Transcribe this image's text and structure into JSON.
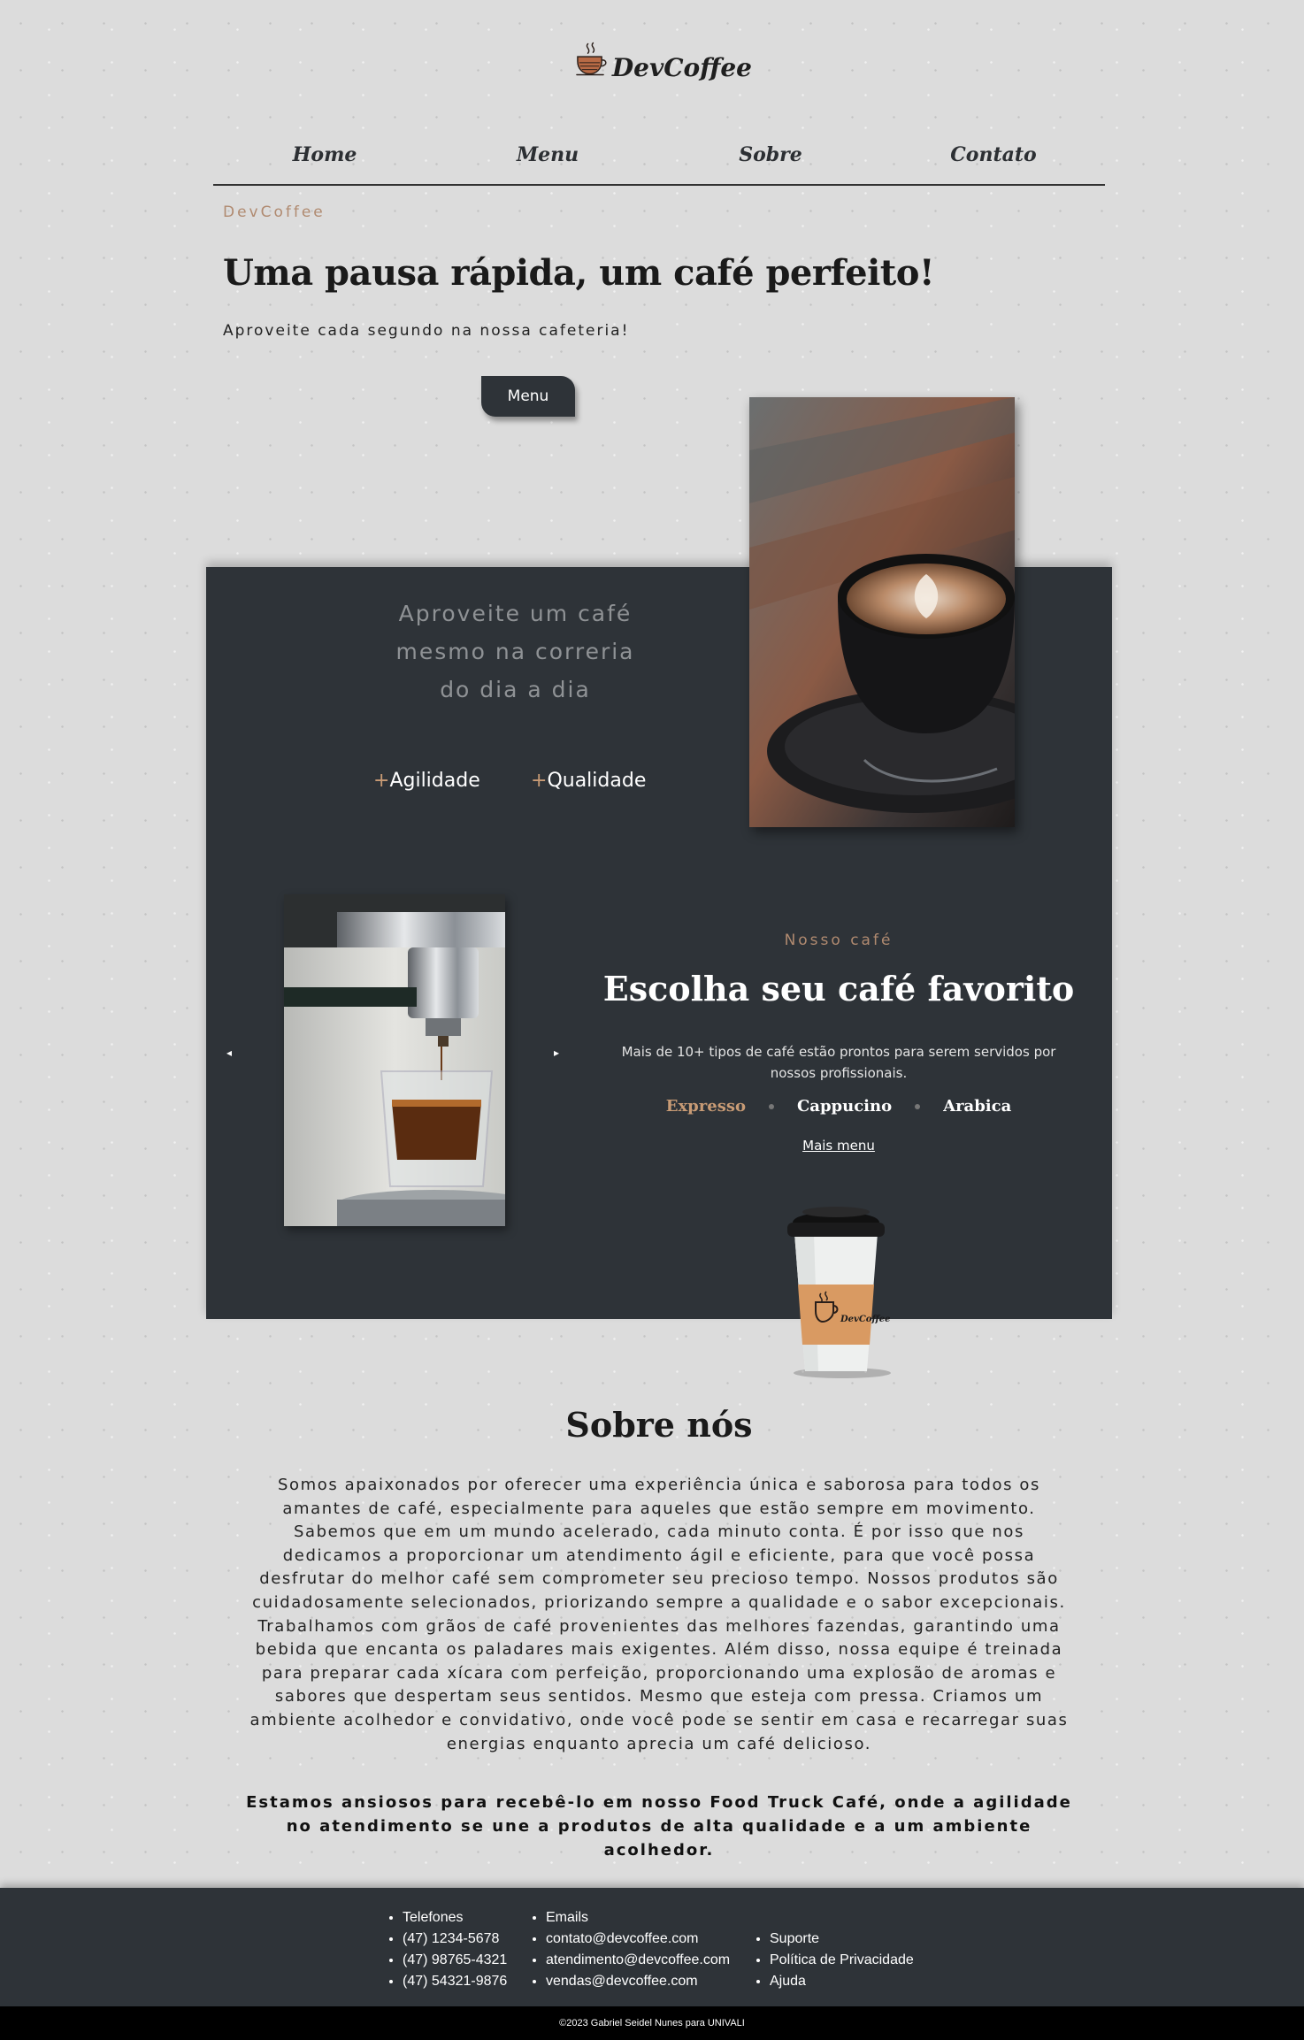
{
  "brand": {
    "name": "DevCoffee"
  },
  "nav": [
    {
      "label": "Home"
    },
    {
      "label": "Menu"
    },
    {
      "label": "Sobre"
    },
    {
      "label": "Contato"
    }
  ],
  "hero": {
    "eyebrow": "DevCoffee",
    "title": "Uma pausa rápida, um café perfeito!",
    "subtitle": "Aproveite cada segundo na nossa cafeteria!",
    "button_label": "Menu"
  },
  "highlight": {
    "lines": [
      "Aproveite um café",
      "mesmo na correria",
      "do dia a dia"
    ],
    "features": [
      {
        "plus": "+",
        "label": "Agilidade"
      },
      {
        "plus": "+",
        "label": "Qualidade"
      }
    ]
  },
  "our_coffee": {
    "eyebrow": "Nosso café",
    "title": "Escolha seu café favorito",
    "description": "Mais de 10+ tipos de café estão prontos para serem servidos por nossos profissionais.",
    "varieties": [
      "Expresso",
      "Cappucino",
      "Arabica"
    ],
    "more_link": "Mais menu",
    "cup_brand": "DevCoffee",
    "prev_arrow": "◂",
    "next_arrow": "▸"
  },
  "about": {
    "title": "Sobre nós",
    "text": "Somos apaixonados por oferecer uma experiência única e saborosa para todos os amantes de café, especialmente para aqueles que estão sempre em movimento. Sabemos que em um mundo acelerado, cada minuto conta. É por isso que nos dedicamos a proporcionar um atendimento ágil e eficiente, para que você possa desfrutar do melhor café sem comprometer seu precioso tempo. Nossos produtos são cuidadosamente selecionados, priorizando sempre a qualidade e o sabor excepcionais. Trabalhamos com grãos de café provenientes das melhores fazendas, garantindo uma bebida que encanta os paladares mais exigentes. Além disso, nossa equipe é treinada para preparar cada xícara com perfeição, proporcionando uma explosão de aromas e sabores que despertam seus sentidos. Mesmo que esteja com pressa. Criamos um ambiente acolhedor e convidativo, onde você pode se sentir em casa e recarregar suas energias enquanto aprecia um café delicioso.",
    "closing": "Estamos ansiosos para recebê-lo em nosso Food Truck Café, onde a agilidade no atendimento se une a produtos de alta qualidade e a um ambiente acolhedor."
  },
  "footer": {
    "phones": [
      "Telefones",
      "(47) 1234-5678",
      "(47) 98765-4321",
      "(47) 54321-9876"
    ],
    "emails": [
      "Emails",
      "contato@devcoffee.com",
      "atendimento@devcoffee.com",
      "vendas@devcoffee.com"
    ],
    "links": [
      "Suporte",
      "Política de Privacidade",
      "Ajuda"
    ],
    "copyright": "©2023 Gabriel Seidel Nunes para UNIVALI"
  },
  "colors": {
    "background": "#dcdcdc",
    "dark_panel": "#2e3338",
    "accent": "#c89b75",
    "eyebrow": "#b08a70"
  }
}
